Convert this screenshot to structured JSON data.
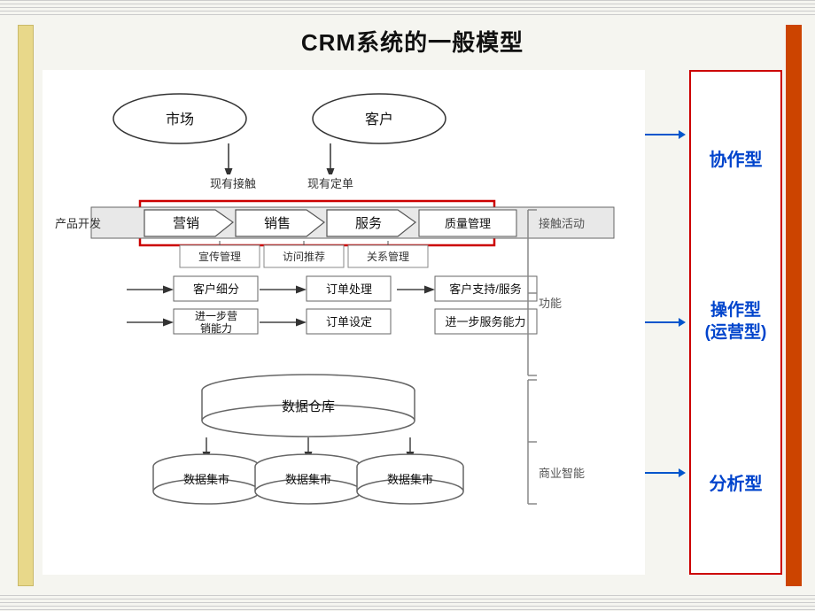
{
  "title": {
    "prefix": "CRM",
    "suffix": "系统的一般模型"
  },
  "diagram": {
    "market_label": "市场",
    "customer_label": "客户",
    "contact_label": "现有接触",
    "order_label": "现有定单",
    "product_dev": "产品开发",
    "marketing": "营销",
    "sales": "销售",
    "service": "服务",
    "quality_mgmt": "质量管理",
    "promo_mgmt": "宣传管理",
    "visit_promo": "访问推荐",
    "relation_mgmt": "关系管理",
    "customer_seg": "客户细分",
    "order_process": "订单处理",
    "customer_support": "客户支持/服务",
    "further_marketing": "进一步营销能力",
    "order_setup": "订单设定",
    "further_service": "进一步服务能力",
    "data_warehouse": "数据仓库",
    "data_set1": "数据集市",
    "data_set2": "数据集市",
    "data_set3": "数据集市",
    "touch_activity": "接触活动",
    "function": "功能",
    "business_intelligence": "商业智能"
  },
  "right_panel": {
    "type1_label": "协作型",
    "type2_label": "操作型\n(运营型)",
    "type3_label": "分析型",
    "arrow1_prefix": "",
    "arrow2_prefix": "",
    "arrow3_prefix": "—"
  }
}
